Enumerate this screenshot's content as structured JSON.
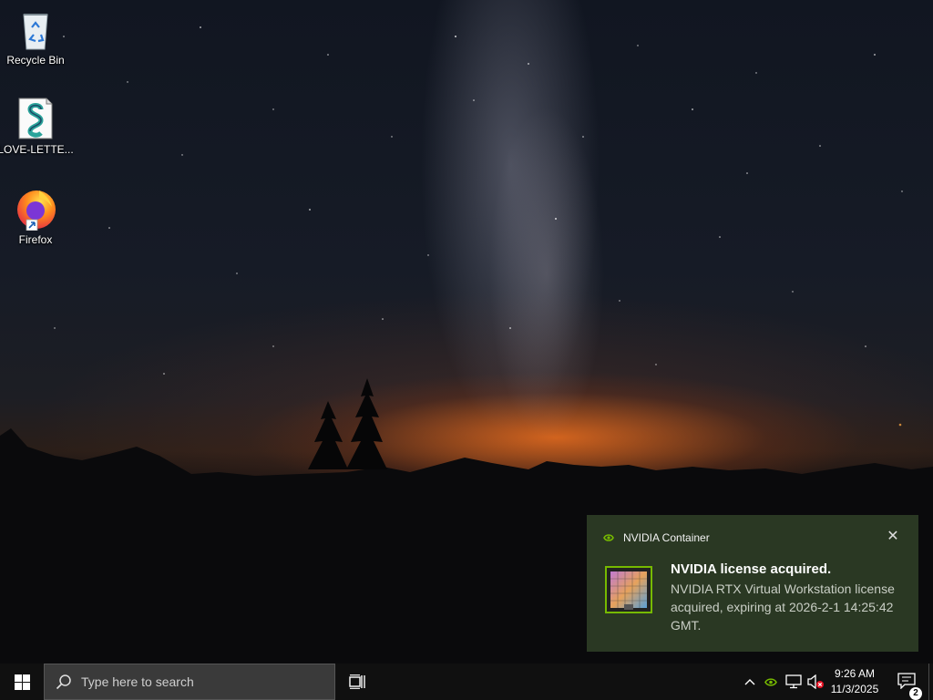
{
  "desktop": {
    "icons": [
      {
        "label": "Recycle Bin",
        "icon": "recycle-bin-icon"
      },
      {
        "label": "LOVE-LETTE...",
        "icon": "script-file-icon"
      },
      {
        "label": "Firefox",
        "icon": "firefox-icon"
      }
    ]
  },
  "notification": {
    "app_name": "NVIDIA Container",
    "title": "NVIDIA license acquired.",
    "body": "NVIDIA RTX Virtual Workstation license acquired, expiring at 2026-2-1 14:25:42 GMT.",
    "close_icon": "close-icon",
    "accent": "#76b900"
  },
  "taskbar": {
    "start_icon": "windows-logo-icon",
    "search": {
      "placeholder": "Type here to search",
      "icon": "search-icon"
    },
    "task_view_icon": "task-view-icon",
    "tray": {
      "overflow_icon": "chevron-up-icon",
      "nvidia_icon": "nvidia-icon",
      "network_icon": "network-icon",
      "volume_icon": "volume-muted-icon"
    },
    "clock": {
      "time": "9:26 AM",
      "date": "11/3/2025"
    },
    "action_center": {
      "icon": "notification-icon",
      "count": "2"
    }
  },
  "colors": {
    "taskbar_bg": "#101010",
    "search_bg": "#3a3a3a",
    "toast_bg": "#2c3a24"
  }
}
